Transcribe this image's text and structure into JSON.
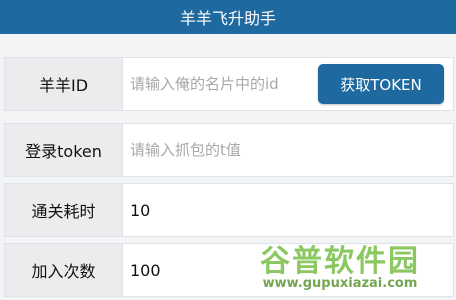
{
  "app": {
    "title": "羊羊飞升助手"
  },
  "form": {
    "sheep_id": {
      "label": "羊羊ID",
      "placeholder": "请输入俺的名片中的id",
      "value": ""
    },
    "get_token_button": "获取TOKEN",
    "login_token": {
      "label": "登录token",
      "placeholder": "请输入抓包的t值",
      "value": ""
    },
    "clear_time": {
      "label": "通关耗时",
      "value": "10"
    },
    "join_count": {
      "label": "加入次数",
      "value": "100"
    }
  },
  "watermark": {
    "title": "谷普软件园",
    "url": "www.gupuxiazai.com"
  },
  "colors": {
    "brand": "#1e6aa0",
    "label_bg": "#ececee",
    "watermark": "#78be46"
  }
}
